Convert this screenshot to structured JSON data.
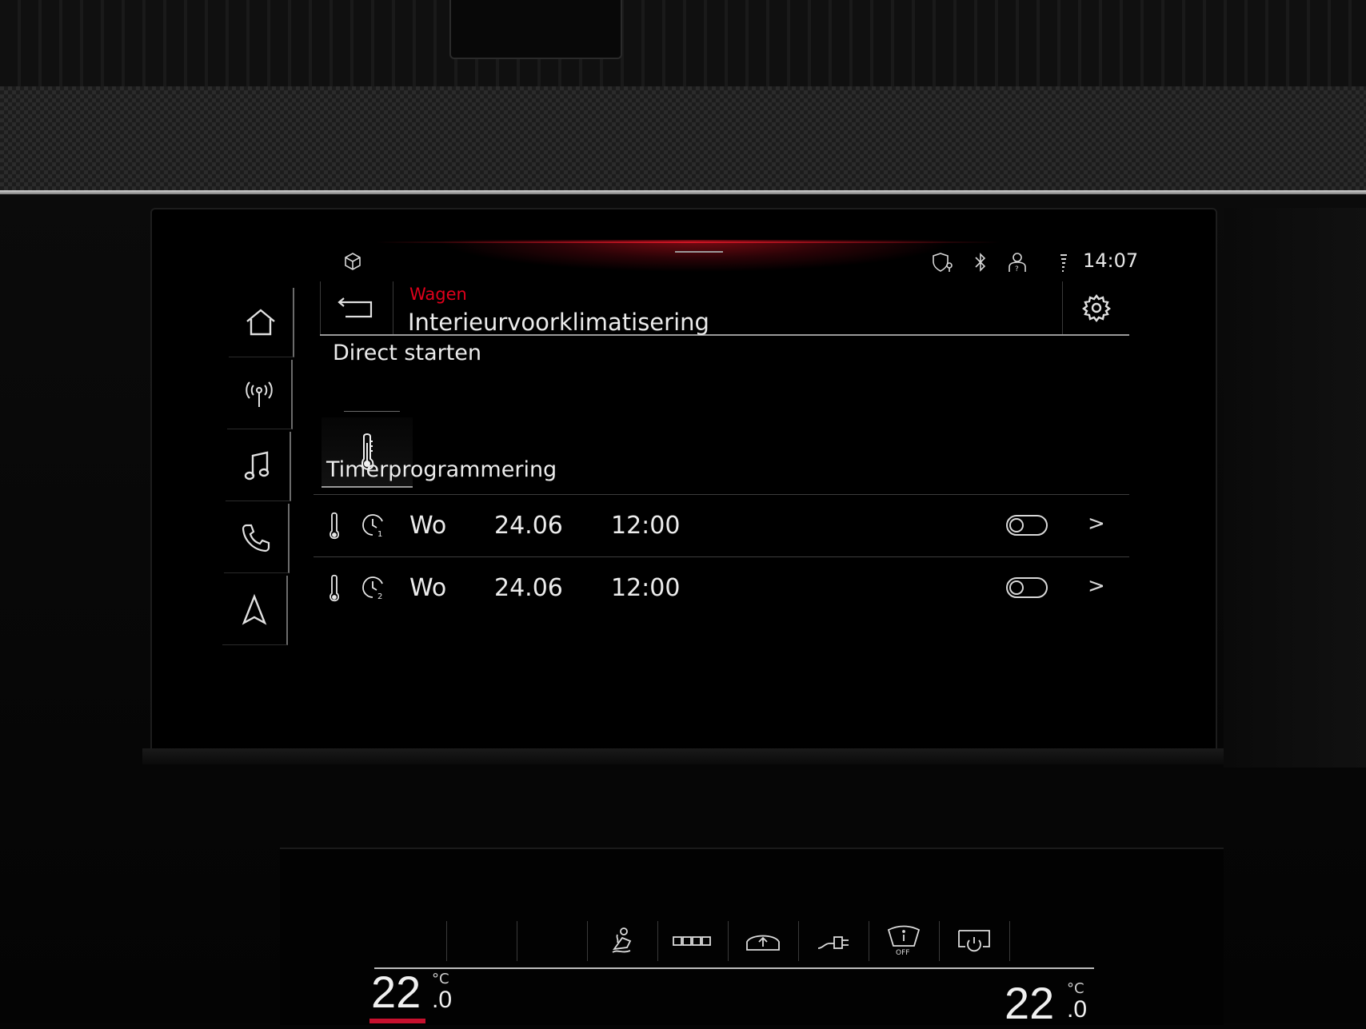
{
  "status_bar": {
    "time": "14:07",
    "icons": [
      "car-box-icon",
      "shield-location-icon",
      "bluetooth-icon",
      "user-profile-icon",
      "signal-icon"
    ]
  },
  "nav": {
    "items": [
      {
        "icon": "home-icon"
      },
      {
        "icon": "radio-icon"
      },
      {
        "icon": "music-icon"
      },
      {
        "icon": "phone-icon"
      },
      {
        "icon": "navigation-icon"
      }
    ]
  },
  "header": {
    "breadcrumb": "Wagen",
    "title": "Interieurvoorklimatisering",
    "back_icon": "back-arrow-icon",
    "settings_icon": "gear-icon"
  },
  "direct_start": {
    "title": "Direct starten",
    "icon": "thermometer-icon"
  },
  "timer": {
    "title": "Timerprogrammering",
    "rows": [
      {
        "timer_number": "1",
        "day": "Wo",
        "date": "24.06",
        "time": "12:00",
        "enabled": false
      },
      {
        "timer_number": "2",
        "day": "Wo",
        "date": "24.06",
        "time": "12:00",
        "enabled": false
      }
    ]
  },
  "climate": {
    "left_temp": "22",
    "left_temp_decimal": ".0",
    "right_temp": "22",
    "right_temp_decimal": ".0",
    "unit": "°C",
    "icons": [
      "seat-heating-icon",
      "rear-defrost-icon",
      "recirculation-icon",
      "charging-plug-icon",
      "windshield-off-icon",
      "power-icon"
    ],
    "windshield_label": "OFF",
    "accent": "#c8102e"
  },
  "colors": {
    "accent_red": "#e0001b",
    "text": "#ececec"
  }
}
